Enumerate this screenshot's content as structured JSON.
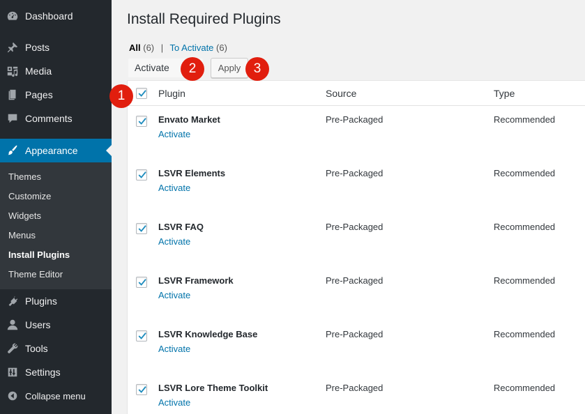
{
  "sidebar": {
    "items": [
      {
        "label": "Dashboard",
        "icon": "dashboard-icon"
      },
      {
        "label": "Posts",
        "icon": "pin-icon"
      },
      {
        "label": "Media",
        "icon": "media-icon"
      },
      {
        "label": "Pages",
        "icon": "pages-icon"
      },
      {
        "label": "Comments",
        "icon": "comments-icon"
      },
      {
        "label": "Appearance",
        "icon": "brush-icon"
      },
      {
        "label": "Plugins",
        "icon": "plugins-icon"
      },
      {
        "label": "Users",
        "icon": "users-icon"
      },
      {
        "label": "Tools",
        "icon": "wrench-icon"
      },
      {
        "label": "Settings",
        "icon": "settings-icon"
      },
      {
        "label": "Collapse menu",
        "icon": "collapse-icon"
      }
    ],
    "submenu": [
      "Themes",
      "Customize",
      "Widgets",
      "Menus",
      "Install Plugins",
      "Theme Editor"
    ]
  },
  "page": {
    "title": "Install Required Plugins",
    "filters": {
      "all_label": "All",
      "all_count": "(6)",
      "separator": "|",
      "to_activate_label": "To Activate",
      "to_activate_count": "(6)"
    },
    "bulk_action_value": "Activate",
    "apply_label": "Apply",
    "badges": [
      "1",
      "2",
      "3"
    ]
  },
  "table": {
    "columns": [
      "Plugin",
      "Source",
      "Type"
    ],
    "rows": [
      {
        "name": "Envato Market",
        "action": "Activate",
        "source": "Pre-Packaged",
        "type": "Recommended"
      },
      {
        "name": "LSVR Elements",
        "action": "Activate",
        "source": "Pre-Packaged",
        "type": "Recommended"
      },
      {
        "name": "LSVR FAQ",
        "action": "Activate",
        "source": "Pre-Packaged",
        "type": "Recommended"
      },
      {
        "name": "LSVR Framework",
        "action": "Activate",
        "source": "Pre-Packaged",
        "type": "Recommended"
      },
      {
        "name": "LSVR Knowledge Base",
        "action": "Activate",
        "source": "Pre-Packaged",
        "type": "Recommended"
      },
      {
        "name": "LSVR Lore Theme Toolkit",
        "action": "Activate",
        "source": "Pre-Packaged",
        "type": "Recommended"
      }
    ]
  },
  "colors": {
    "sidebar_bg": "#23282d",
    "accent": "#0073aa",
    "badge": "#e11e0e"
  }
}
